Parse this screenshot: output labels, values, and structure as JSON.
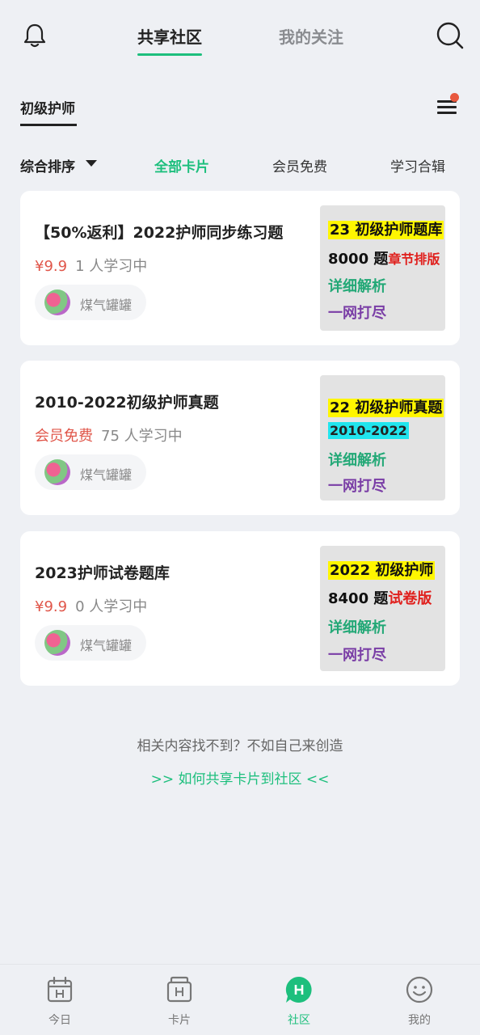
{
  "header": {
    "tabs": [
      {
        "label": "共享社区",
        "active": true
      },
      {
        "label": "我的关注",
        "active": false
      }
    ],
    "icons": {
      "left": "bell-icon",
      "right": "search-icon"
    }
  },
  "category": {
    "label": "初级护师",
    "menu_icon": "menu-icon",
    "has_notification_dot": true
  },
  "filters": {
    "sort_label": "综合排序",
    "items": [
      {
        "label": "全部卡片",
        "active": true
      },
      {
        "label": "会员免费",
        "active": false
      },
      {
        "label": "学习合辑",
        "active": false
      }
    ]
  },
  "cards": [
    {
      "title": "【50%返利】2022护师同步练习题",
      "price": "¥9.9",
      "learners": "1 人学习中",
      "author": "煤气罐罐",
      "thumb": {
        "line1_a": "23 初级护师题库",
        "line2_a": "8000 题",
        "line2_b": "章节排版",
        "line3": "详细解析",
        "line4": "一网打尽"
      }
    },
    {
      "title": "2010-2022初级护师真题",
      "price": "会员免费",
      "learners": "75 人学习中",
      "author": "煤气罐罐",
      "thumb": {
        "line1_a": "22 初级护师真题",
        "line2_a": "2010-2022",
        "line3": "详细解析",
        "line4": "一网打尽"
      }
    },
    {
      "title": "2023护师试卷题库",
      "price": "¥9.9",
      "learners": "0 人学习中",
      "author": "煤气罐罐",
      "thumb": {
        "line1_a": "2022 初级护师",
        "line2_a": "8400 题",
        "line2_b": "试卷版",
        "line3": "详细解析",
        "line4": "一网打尽"
      }
    }
  ],
  "footer_hint": {
    "text": "相关内容找不到？不如自己来创造",
    "link": ">> 如何共享卡片到社区 <<"
  },
  "bottom_nav": [
    {
      "label": "今日",
      "icon": "calendar-icon",
      "active": false
    },
    {
      "label": "卡片",
      "icon": "card-box-icon",
      "active": false
    },
    {
      "label": "社区",
      "icon": "community-icon",
      "active": true
    },
    {
      "label": "我的",
      "icon": "smiley-icon",
      "active": false
    }
  ],
  "colors": {
    "accent": "#1dbf7d",
    "price_red": "#e0564a",
    "background": "#eef0f4",
    "notification_dot": "#e8583e"
  }
}
